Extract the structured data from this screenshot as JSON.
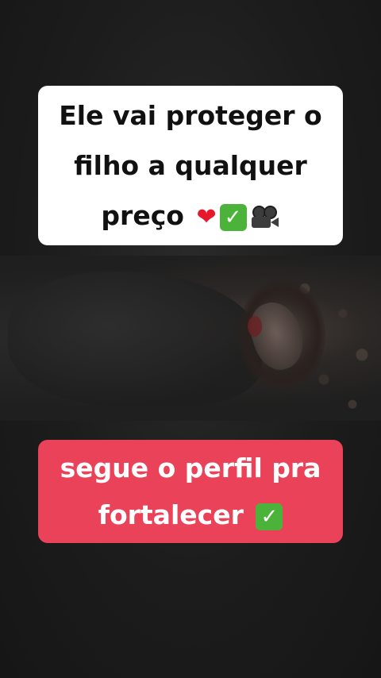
{
  "top_caption": {
    "lines": [
      "Ele vai proteger o",
      "filho a qualquer",
      "preço"
    ],
    "emojis": [
      "heart-icon",
      "check-icon",
      "camera-icon"
    ],
    "heart_glyph": "❤",
    "check_glyph": "✓",
    "background": "#ffffff",
    "text_color": "#111111"
  },
  "bottom_caption": {
    "lines": [
      "segue o perfil pra",
      "fortalecer"
    ],
    "check_glyph": "✓",
    "background": "#ea4359",
    "text_color": "#ffffff"
  },
  "colors": {
    "page_background": "#1a1a1a",
    "check_green": "#4cb33a",
    "heart_red": "#e8182c"
  }
}
